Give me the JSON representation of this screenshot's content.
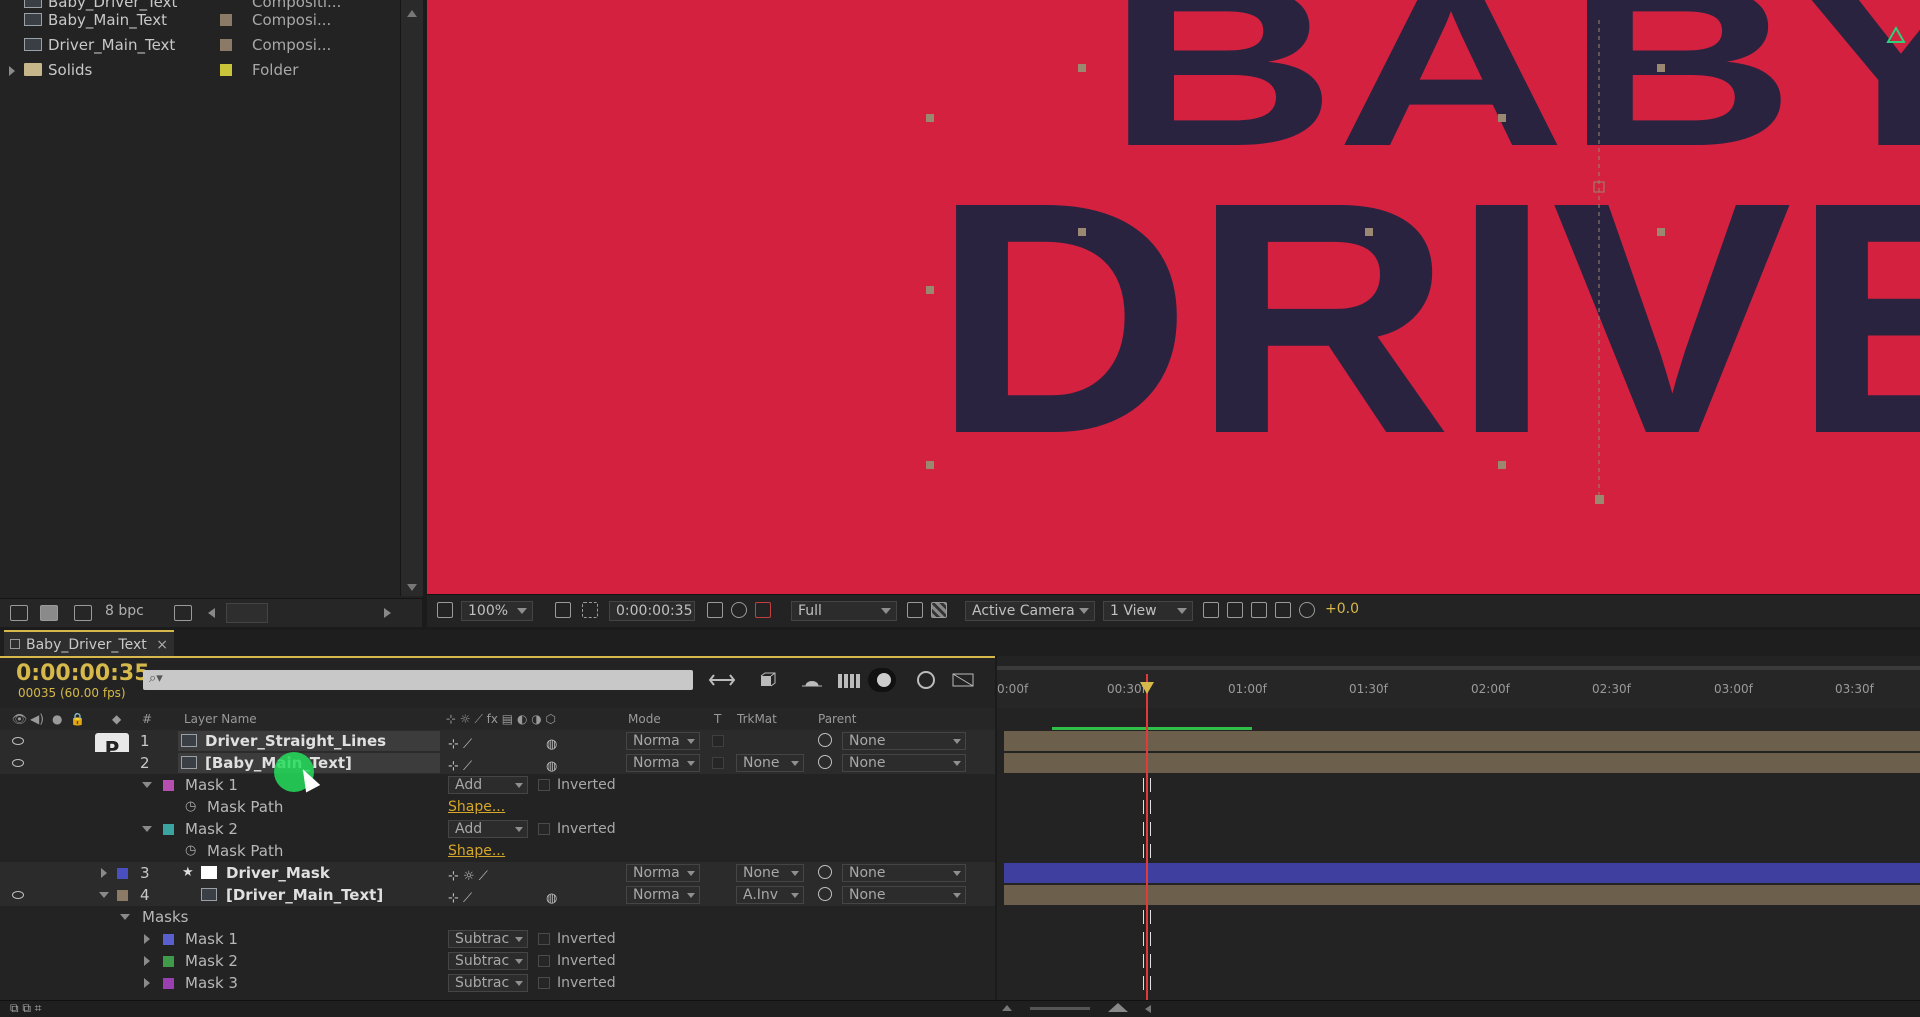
{
  "project": {
    "items": [
      {
        "name": "Baby_Driver_Text",
        "type": "Compositi..."
      },
      {
        "name": "Baby_Main_Text",
        "type": "Composi...",
        "swatch": "#8a7a66"
      },
      {
        "name": "Driver_Main_Text",
        "type": "Composi...",
        "swatch": "#8a7a66"
      },
      {
        "name": "Solids",
        "type": "Folder",
        "swatch": "#c9c43a"
      }
    ],
    "footer": {
      "bpc": "8 bpc"
    }
  },
  "viewer": {
    "background": "#d4213f",
    "text_color": "#2a2340",
    "line1": "BABY",
    "line2": "DRIVE",
    "corner_icon": "triangle-logo-icon"
  },
  "viewer_bar": {
    "zoom": "100%",
    "timecode": "0:00:00:35",
    "resolution": "Full",
    "camera": "Active Camera",
    "view": "1 View",
    "exposure": "+0.0"
  },
  "timeline": {
    "tab": "Baby_Driver_Text",
    "timecode": "0:00:00:35",
    "frames_fps": "00035 (60.00 fps)",
    "columns": {
      "num": "#",
      "layer_name": "Layer Name",
      "mode": "Mode",
      "t": "T",
      "trkmat": "TrkMat",
      "parent": "Parent"
    },
    "ruler": [
      "0:00f",
      "00:30f",
      "01:00f",
      "01:30f",
      "02:00f",
      "02:30f",
      "03:00f",
      "03:30f"
    ],
    "rows": [
      {
        "kind": "layer",
        "num": "1",
        "name": "Driver_Straight_Lines",
        "mode": "Norma",
        "trkmat": "",
        "parent": "None"
      },
      {
        "kind": "layer",
        "num": "2",
        "name": "[Baby_Main_Text]",
        "mode": "Norma",
        "trkmat": "None",
        "parent": "None"
      },
      {
        "kind": "mask",
        "name": "Mask 1",
        "mode": "Add",
        "inverted": "Inverted",
        "swatch": "#b64fb0"
      },
      {
        "kind": "prop",
        "name": "Mask Path",
        "value": "Shape..."
      },
      {
        "kind": "mask",
        "name": "Mask 2",
        "mode": "Add",
        "inverted": "Inverted",
        "swatch": "#3aa5a0"
      },
      {
        "kind": "prop",
        "name": "Mask Path",
        "value": "Shape..."
      },
      {
        "kind": "layer",
        "num": "3",
        "name": "Driver_Mask",
        "mode": "Norma",
        "trkmat": "None",
        "parent": "None"
      },
      {
        "kind": "layer",
        "num": "4",
        "name": "[Driver_Main_Text]",
        "mode": "Norma",
        "trkmat": "A.Inv",
        "parent": "None"
      },
      {
        "kind": "group",
        "name": "Masks"
      },
      {
        "kind": "mask",
        "name": "Mask 1",
        "mode": "Subtrac",
        "inverted": "Inverted",
        "swatch": "#5a5fd0"
      },
      {
        "kind": "mask",
        "name": "Mask 2",
        "mode": "Subtrac",
        "inverted": "Inverted",
        "swatch": "#3f9a4a"
      },
      {
        "kind": "mask",
        "name": "Mask 3",
        "mode": "Subtrac",
        "inverted": "Inverted",
        "swatch": "#9a3fb0"
      }
    ],
    "solo_label": "P",
    "accent": "#d6b94a",
    "playhead_color": "#e03a3a"
  }
}
